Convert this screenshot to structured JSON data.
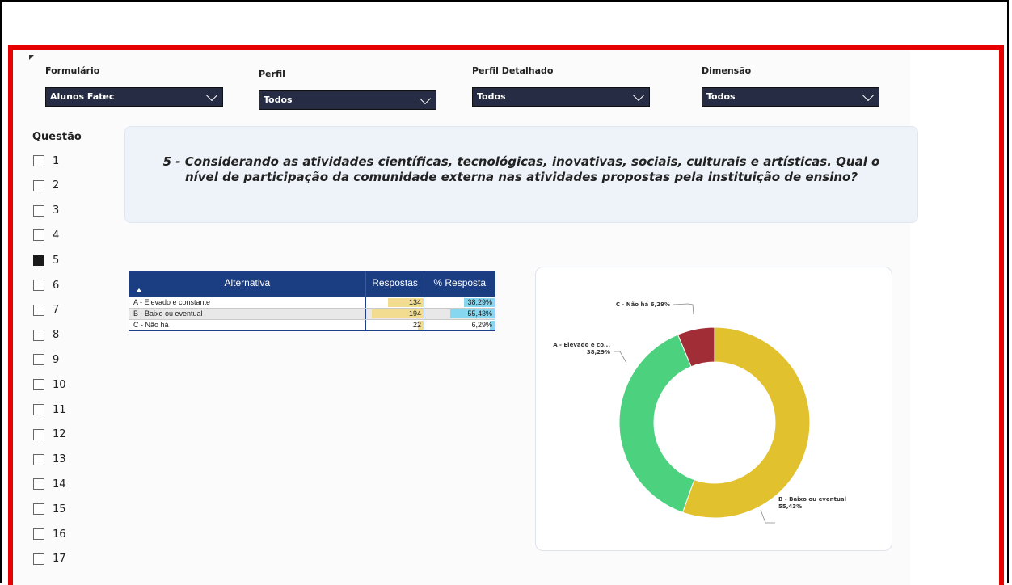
{
  "slicers": {
    "formulario": {
      "label": "Formulário",
      "value": "Alunos Fatec"
    },
    "perfil": {
      "label": "Perfil",
      "value": "Todos"
    },
    "perfil_detalhado": {
      "label": "Perfil Detalhado",
      "value": "Todos"
    },
    "dimensao": {
      "label": "Dimensão",
      "value": "Todos"
    }
  },
  "questao": {
    "label": "Questão",
    "items": [
      "1",
      "2",
      "3",
      "4",
      "5",
      "6",
      "7",
      "8",
      "9",
      "10",
      "11",
      "12",
      "13",
      "14",
      "15",
      "16",
      "17"
    ],
    "selected": "5"
  },
  "question_text": "5 - Considerando as atividades científicas, tecnológicas, inovativas, sociais, culturais e artísticas. Qual o nível de participação da comunidade externa nas atividades propostas pela instituição de ensino?",
  "table": {
    "headers": {
      "alternativa": "Alternativa",
      "respostas": "Respostas",
      "pct": "% Resposta"
    },
    "rows": [
      {
        "alternativa": "A - Elevado e constante",
        "respostas": "134",
        "pct": "38,29%"
      },
      {
        "alternativa": "B - Baixo ou eventual",
        "respostas": "194",
        "pct": "55,43%"
      },
      {
        "alternativa": "C - Não há",
        "respostas": "22",
        "pct": "6,29%"
      }
    ]
  },
  "chart_data": {
    "type": "pie",
    "donut": true,
    "categories": [
      "A - Elevado e co...",
      "B - Baixo ou eventual",
      "C - Não há"
    ],
    "values": [
      134,
      194,
      22
    ],
    "percent_labels": [
      "38,29%",
      "55,43%",
      "6,29%"
    ],
    "colors": [
      "#4cd27f",
      "#e2c12f",
      "#a12e37"
    ],
    "start_category": "B - Baixo ou eventual",
    "labels": {
      "a": {
        "name": "A - Elevado e co...",
        "pct": "38,29%"
      },
      "b": {
        "name": "B - Baixo ou eventual",
        "pct": "55,43%"
      },
      "c": {
        "text": "C - Não há 6,29%"
      }
    }
  }
}
